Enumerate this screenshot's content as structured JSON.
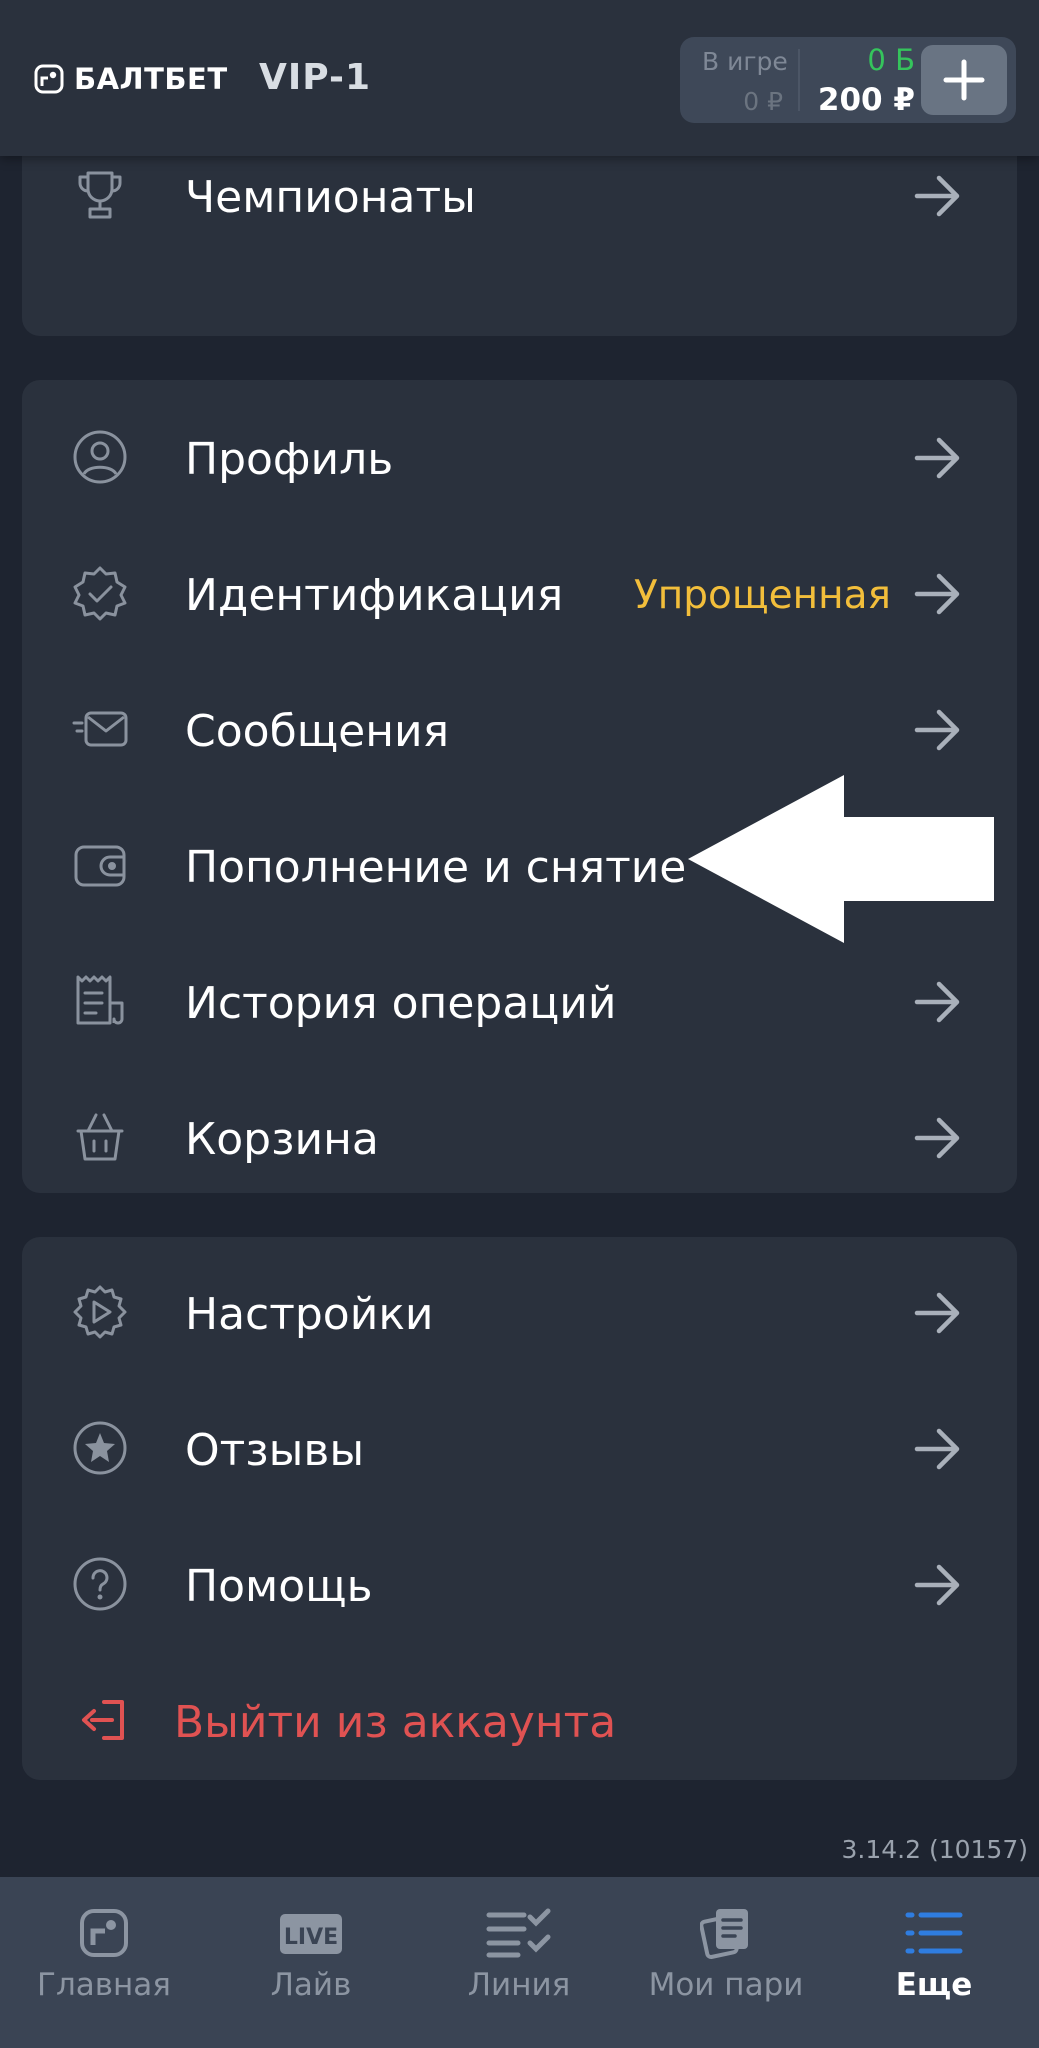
{
  "header": {
    "logo_text": "БАЛТБЕТ",
    "vip_level": "VIP-1",
    "balance": {
      "in_game_label": "В игре",
      "in_game_value": "0 ₽",
      "bonus_value": "0 Б",
      "money_value": "200 ₽"
    },
    "deposit_button_icon": "plus-icon"
  },
  "menu_top": [
    {
      "label": "Чемпионаты",
      "icon": "trophy-icon"
    }
  ],
  "menu_account": [
    {
      "label": "Профиль",
      "icon": "profile-icon"
    },
    {
      "label": "Идентификация",
      "icon": "verified-badge-icon",
      "status": "Упрощенная"
    },
    {
      "label": "Сообщения",
      "icon": "message-icon"
    },
    {
      "label": "Пополнение и снятие",
      "icon": "wallet-icon"
    },
    {
      "label": "История операций",
      "icon": "history-icon"
    },
    {
      "label": "Корзина",
      "icon": "basket-icon"
    }
  ],
  "menu_settings": [
    {
      "label": "Настройки",
      "icon": "gear-icon"
    },
    {
      "label": "Отзывы",
      "icon": "star-icon"
    },
    {
      "label": "Помощь",
      "icon": "help-icon"
    },
    {
      "label": "Выйти из аккаунта",
      "icon": "logout-icon"
    }
  ],
  "version": "3.14.2 (10157)",
  "bottom_nav": [
    {
      "label": "Главная",
      "icon": "home-icon",
      "active": false
    },
    {
      "label": "Лайв",
      "icon": "live-icon",
      "icon_text": "LIVE",
      "active": false
    },
    {
      "label": "Линия",
      "icon": "line-icon",
      "active": false
    },
    {
      "label": "Мои пари",
      "icon": "my-bets-icon",
      "active": false
    },
    {
      "label": "Еще",
      "icon": "more-icon",
      "active": true
    }
  ],
  "colors": {
    "background": "#1e2430",
    "card": "#2a313d",
    "status_yellow": "#f2be3b",
    "logout_red": "#e05252",
    "bonus_green": "#35c45c",
    "active_nav": "#2f7de0"
  }
}
